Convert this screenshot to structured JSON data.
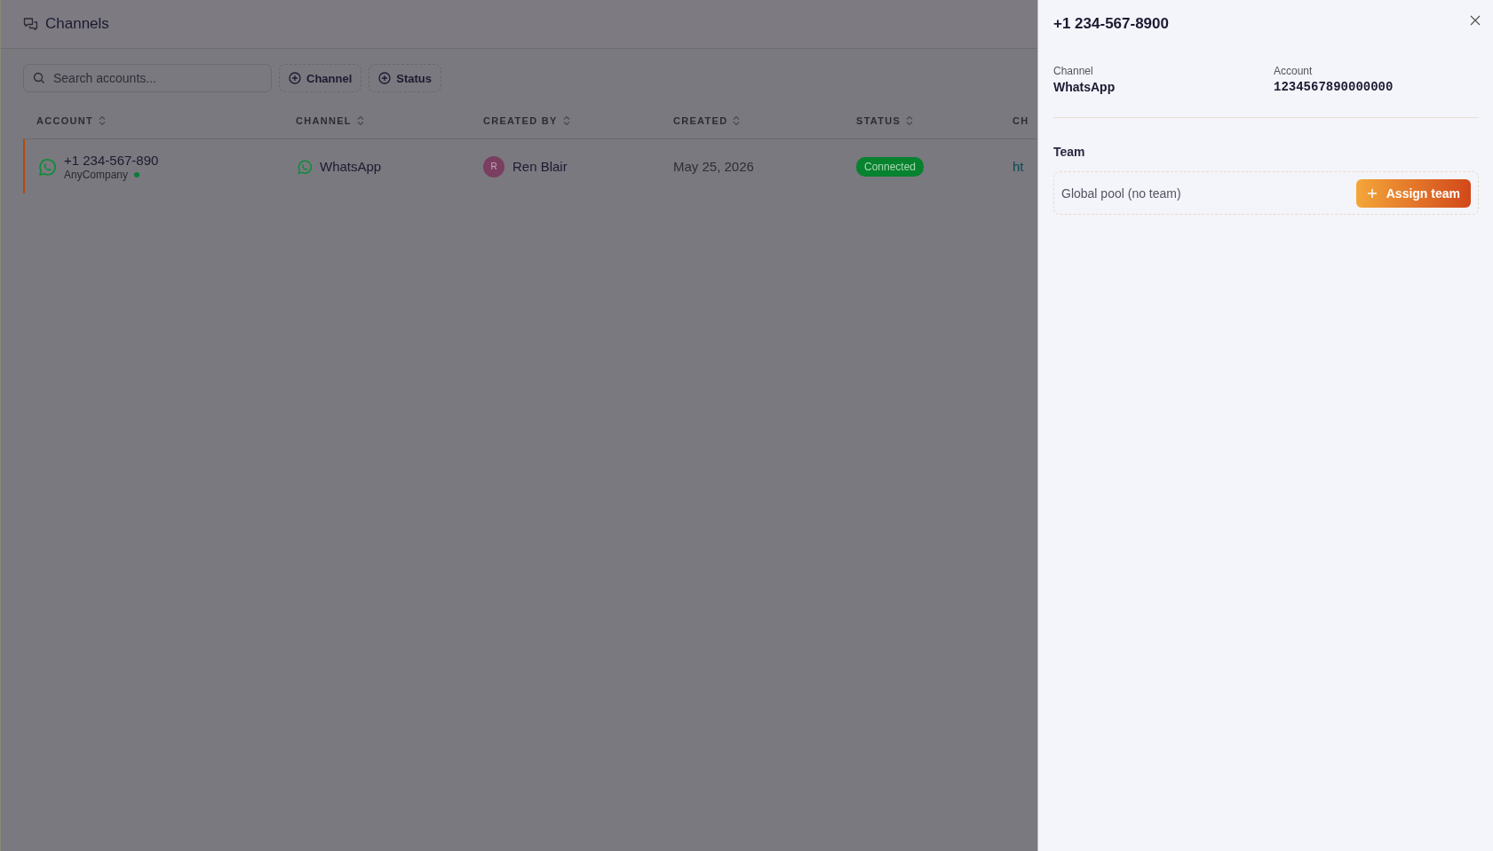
{
  "header": {
    "title": "Channels"
  },
  "toolbar": {
    "search": {
      "placeholder": "Search accounts..."
    },
    "filters": [
      {
        "label": "Channel"
      },
      {
        "label": "Status"
      }
    ]
  },
  "table": {
    "columns": [
      {
        "label": "ACCOUNT",
        "sortable": true
      },
      {
        "label": "CHANNEL",
        "sortable": true
      },
      {
        "label": "CREATED BY",
        "sortable": true
      },
      {
        "label": "CREATED",
        "sortable": true
      },
      {
        "label": "STATUS",
        "sortable": true
      },
      {
        "label": "CH",
        "sortable": false
      }
    ],
    "rows": [
      {
        "selected": true,
        "account": {
          "number": "+1 234-567-890",
          "company": "AnyCompany",
          "online": true
        },
        "channel": "WhatsApp",
        "created_by": {
          "initial": "R",
          "name": "Ren Blair"
        },
        "created": "May 25, 2026",
        "status": {
          "label": "Connected",
          "kind": "connected"
        },
        "column_6": "ht"
      }
    ]
  },
  "panel": {
    "title": "+1 234-567-8900",
    "fields": [
      {
        "label": "Channel",
        "value": "WhatsApp",
        "kind": "text"
      },
      {
        "label": "Account",
        "value": "1234567890000000",
        "kind": "mono"
      }
    ],
    "team": {
      "heading": "Team",
      "value": "Global pool (no team)",
      "button": "Assign team"
    }
  }
}
